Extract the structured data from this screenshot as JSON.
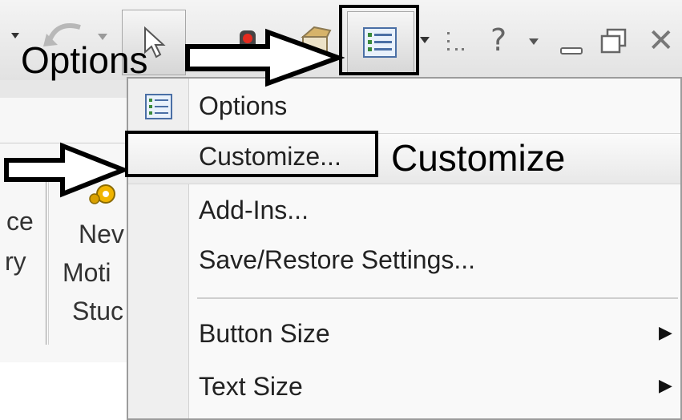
{
  "annotations": {
    "options_label": "Options",
    "customize_label": "Customize"
  },
  "ribbon": {
    "partial_left_top": "ce",
    "partial_left_bottom": "ry",
    "new_motion_study": [
      "Nev",
      "Moti",
      "Stuc"
    ]
  },
  "toolbar": {
    "icons": [
      "undo-icon",
      "select-cursor-icon",
      "traffic-light-icon",
      "rebuild-icon",
      "options-icon",
      "dropdown-arrow-icon",
      "grip-icon",
      "help-icon",
      "minimize-icon",
      "restore-icon",
      "close-icon"
    ]
  },
  "menu": {
    "items": [
      {
        "label": "Options",
        "icon": "options-icon",
        "submenu": false
      },
      {
        "label": "Customize...",
        "highlighted": true,
        "submenu": false
      },
      {
        "label": "Add-Ins...",
        "submenu": false
      },
      {
        "label": "Save/Restore Settings...",
        "submenu": false
      },
      {
        "label": "Button Size",
        "submenu": true
      },
      {
        "label": "Text Size",
        "submenu": true
      }
    ],
    "submenu_arrow": "▶"
  },
  "colors": {
    "menu_background": "#f9f9f9",
    "menu_gutter": "#efefef",
    "highlight_box": "#000000"
  }
}
